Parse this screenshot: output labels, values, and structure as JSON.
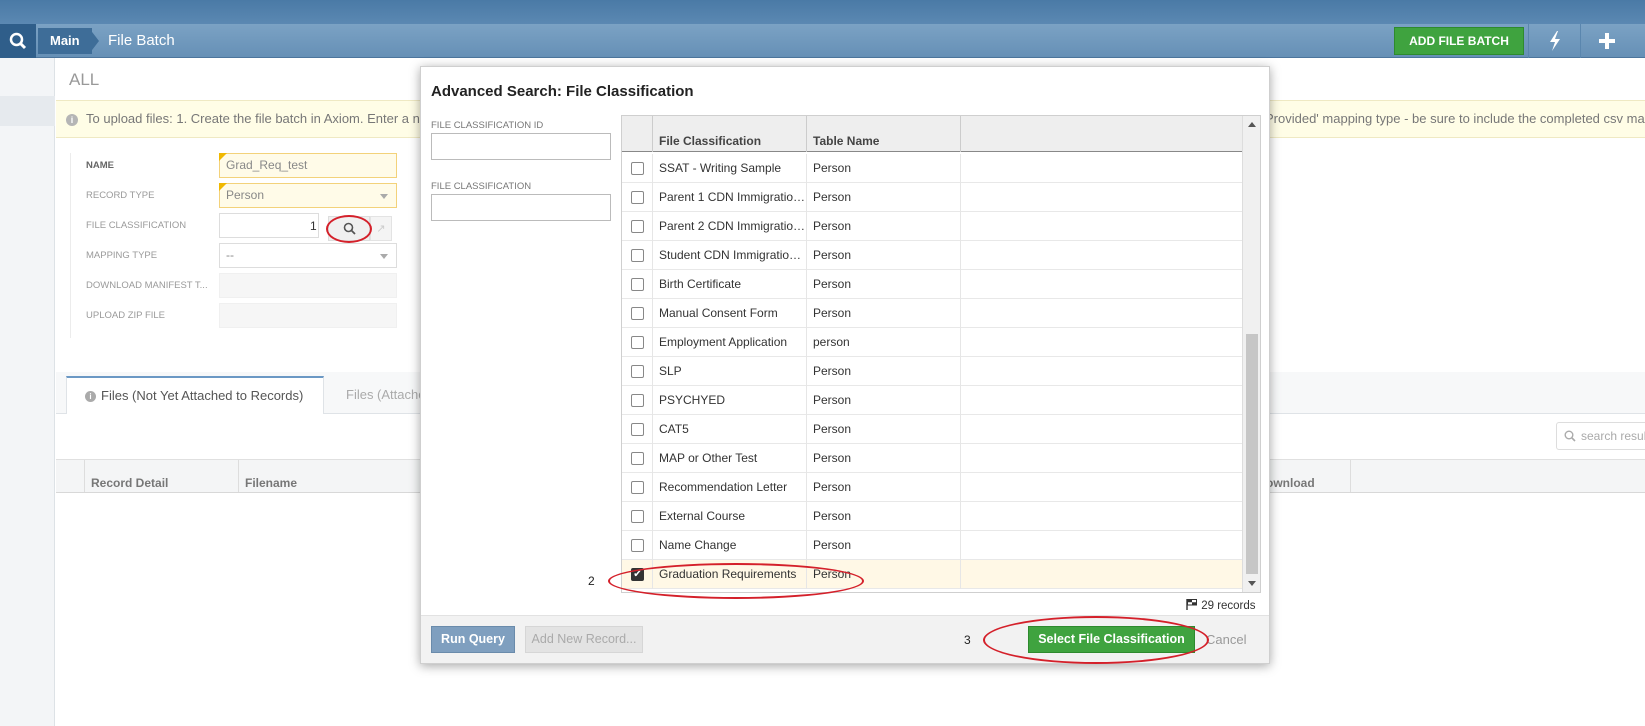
{
  "header": {
    "crumb_main": "Main",
    "title": "File Batch",
    "add_button": "ADD FILE BATCH",
    "colors": {
      "bar": "#6690b6",
      "accent_green": "#3fa33f"
    }
  },
  "page": {
    "scope_label": "ALL",
    "info_text_left": "To upload files: 1. Create the file batch in Axiom. Enter a n",
    "info_text_right": "Provided' mapping type - be sure to include the completed csv ma"
  },
  "form": {
    "name_label": "NAME",
    "name_value": "Grad_Req_test",
    "record_type_label": "RECORD TYPE",
    "record_type_value": "Person",
    "file_classification_label": "FILE CLASSIFICATION",
    "mapping_type_label": "MAPPING TYPE",
    "mapping_type_value": "--",
    "download_manifest_label": "DOWNLOAD MANIFEST T...",
    "upload_zip_label": "UPLOAD ZIP FILE"
  },
  "tabs": {
    "active": "Files (Not Yet Attached to Records)",
    "inactive": "Files (Attache"
  },
  "grid": {
    "search_placeholder": "search resul",
    "col_record_detail": "Record Detail",
    "col_filename": "Filename",
    "col_download": "ownload"
  },
  "annotations": {
    "one": "1",
    "two": "2",
    "three": "3"
  },
  "modal": {
    "title": "Advanced Search: File Classification",
    "field_id_label": "FILE CLASSIFICATION ID",
    "field_class_label": "FILE CLASSIFICATION",
    "col_file_classification": "File Classification",
    "col_table_name": "Table Name",
    "rows": [
      {
        "classification": "SSAT - Writing Sample",
        "table": "Person",
        "checked": false
      },
      {
        "classification": "Parent 1 CDN Immigratio…",
        "table": "Person",
        "checked": false
      },
      {
        "classification": "Parent 2 CDN Immigratio…",
        "table": "Person",
        "checked": false
      },
      {
        "classification": "Student CDN Immigratio…",
        "table": "Person",
        "checked": false
      },
      {
        "classification": "Birth Certificate",
        "table": "Person",
        "checked": false
      },
      {
        "classification": "Manual Consent Form",
        "table": "Person",
        "checked": false
      },
      {
        "classification": "Employment Application",
        "table": "person",
        "checked": false
      },
      {
        "classification": "SLP",
        "table": "Person",
        "checked": false
      },
      {
        "classification": "PSYCHYED",
        "table": "Person",
        "checked": false
      },
      {
        "classification": "CAT5",
        "table": "Person",
        "checked": false
      },
      {
        "classification": "MAP or Other Test",
        "table": "Person",
        "checked": false
      },
      {
        "classification": "Recommendation Letter",
        "table": "Person",
        "checked": false
      },
      {
        "classification": "External Course",
        "table": "Person",
        "checked": false
      },
      {
        "classification": "Name Change",
        "table": "Person",
        "checked": false
      },
      {
        "classification": "Graduation Requirements",
        "table": "Person",
        "checked": true
      }
    ],
    "record_count": "29 records",
    "run_query": "Run Query",
    "add_new_record": "Add New Record...",
    "select_button": "Select File Classification",
    "cancel": "Cancel"
  }
}
